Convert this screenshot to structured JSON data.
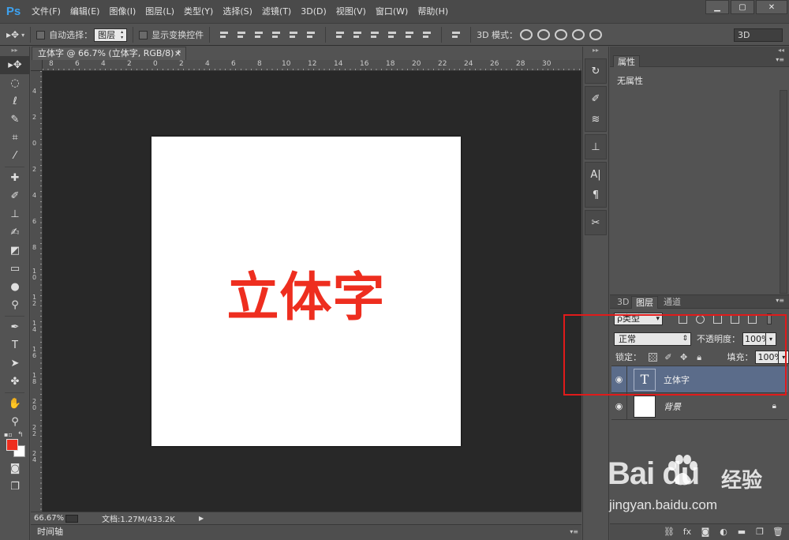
{
  "app": {
    "logo": "Ps",
    "window_controls": [
      "▁",
      "▢",
      "✕"
    ]
  },
  "menu": [
    "文件(F)",
    "编辑(E)",
    "图像(I)",
    "图层(L)",
    "类型(Y)",
    "选择(S)",
    "滤镜(T)",
    "3D(D)",
    "视图(V)",
    "窗口(W)",
    "帮助(H)"
  ],
  "options": {
    "auto_select_label": "自动选择：",
    "auto_select_value": "图层",
    "show_transform_label": "显示变换控件",
    "mode3d_label": "3D 模式：",
    "workspace": "3D"
  },
  "document": {
    "tab_title": "立体字 @ 66.7% (立体字, RGB/8) *",
    "tab_close": "×",
    "canvas_text": "立体字",
    "text_color": "#ee2e1f",
    "ruler_top": [
      "8",
      "6",
      "4",
      "2",
      "0",
      "2",
      "4",
      "6",
      "8",
      "10",
      "12",
      "14",
      "16",
      "18",
      "20",
      "22",
      "24",
      "26",
      "28",
      "30"
    ],
    "ruler_left": [
      "4",
      "2",
      "0",
      "2",
      "4",
      "6",
      "8",
      "1 0",
      "1 2",
      "1 4",
      "1 6",
      "1 8",
      "2 0",
      "2 2",
      "2 4"
    ]
  },
  "status": {
    "zoom": "66.67%",
    "doc_size": "文档:1.27M/433.2K",
    "arrow": "▶"
  },
  "timeline": {
    "label": "时间轴"
  },
  "colors": {
    "foreground": "#ee2e1f",
    "background": "#ffffff"
  },
  "properties": {
    "tab": "属性",
    "empty": "无属性"
  },
  "layers_panel": {
    "tabs": [
      "3D",
      "图层",
      "通道"
    ],
    "filter": "ρ类型",
    "blend_mode": "正常",
    "opacity_label": "不透明度：",
    "opacity": "100%",
    "lock_label": "锁定：",
    "fill_label": "填充：",
    "fill": "100%",
    "layers": [
      {
        "name": "立体字",
        "thumb": "T",
        "selected": true
      },
      {
        "name": "背景",
        "thumb": "",
        "selected": false
      }
    ]
  },
  "watermark": {
    "brand": "Bai   du",
    "cn": "经验",
    "url": "jingyan.baidu.com"
  },
  "highlight_color": "#e01b1b"
}
